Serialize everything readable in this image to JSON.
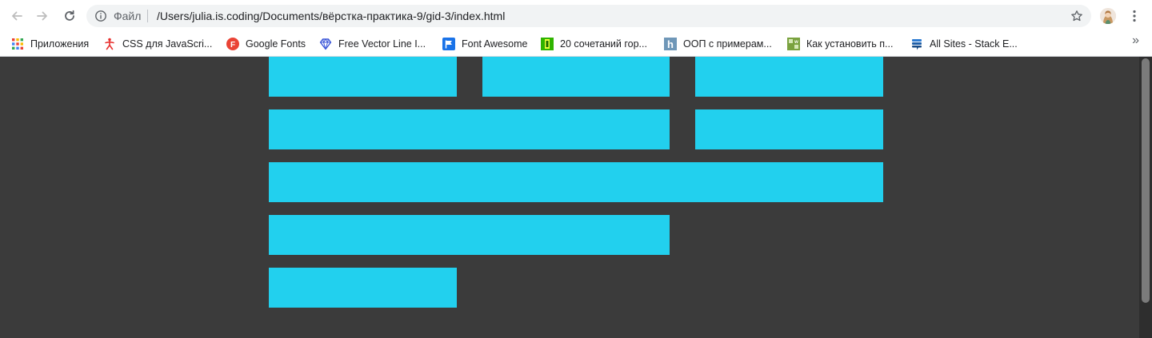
{
  "toolbar": {
    "back_icon": "arrow-left-icon",
    "forward_icon": "arrow-right-icon",
    "reload_icon": "reload-icon",
    "omnibox": {
      "scheme_label": "Файл",
      "url": "/Users/julia.is.coding/Documents/вёрстка-практика-9/gid-3/index.html",
      "info_icon": "info-icon",
      "bookmark_icon": "star-icon"
    },
    "profile_icon": "avatar",
    "menu_icon": "kebab-menu-icon"
  },
  "bookmarks": {
    "items": [
      {
        "label": "Приложения",
        "icon": "apps-grid-icon"
      },
      {
        "label": "CSS для JavaScri...",
        "icon": "figure-icon"
      },
      {
        "label": "Google Fonts",
        "icon": "google-fonts-icon",
        "color": "#ea4335"
      },
      {
        "label": "Free Vector Line I...",
        "icon": "diamond-icon",
        "color": "#3b57d8"
      },
      {
        "label": "Font Awesome",
        "icon": "flag-icon",
        "color": "#1a73e8"
      },
      {
        "label": "20 сочетаний гор...",
        "icon": "green-figure-icon",
        "color": "#2fb400"
      },
      {
        "label": "ООП с примерам...",
        "icon": "h-icon",
        "color": "#6f97b8"
      },
      {
        "label": "Как установить п...",
        "icon": "wiki-icon",
        "color": "#7aa23f"
      },
      {
        "label": "All Sites - Stack E...",
        "icon": "stack-exchange-icon",
        "color": "#1f5fa8"
      }
    ],
    "more_label": "»"
  },
  "page": {
    "background": "#3b3b3b",
    "block_color": "#22d0ee"
  }
}
